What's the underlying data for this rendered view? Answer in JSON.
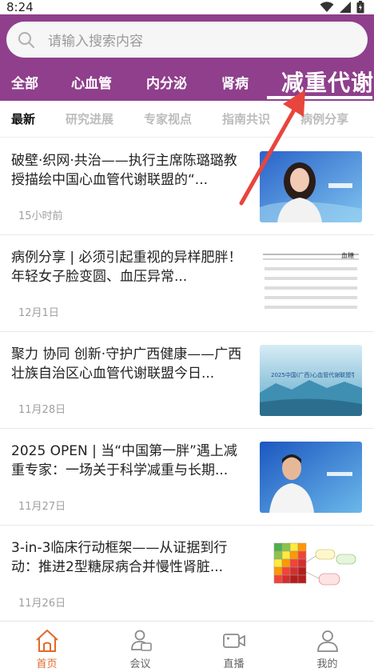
{
  "status_bar": {
    "time": "8:24"
  },
  "search": {
    "placeholder": "请输入搜索内容"
  },
  "categories": [
    {
      "label": "全部"
    },
    {
      "label": "心血管"
    },
    {
      "label": "内分泌"
    },
    {
      "label": "肾病"
    },
    {
      "label": "减重代谢",
      "active": true
    }
  ],
  "subtabs": [
    {
      "label": "最新",
      "active": true
    },
    {
      "label": "研究进展"
    },
    {
      "label": "专家视点"
    },
    {
      "label": "指南共识"
    },
    {
      "label": "病例分享"
    }
  ],
  "articles": [
    {
      "title": "破壁·织网·共治——执行主席陈璐璐教授描绘中国心血管代谢联盟的“...",
      "date": "15小时前",
      "thumb": "portrait-woman-blue"
    },
    {
      "title": "病例分享 | 必须引起重视的异样肥胖！年轻女子脸变圆、血压异常...",
      "date": "12月1日",
      "thumb": "lab-table",
      "thumb_text": "血糖"
    },
    {
      "title": "聚力 协同 创新·守护广西健康——广西壮族自治区心血管代谢联盟今日...",
      "date": "11月28日",
      "thumb": "conference-banner",
      "thumb_text": "2025中国(广西)心血管代谢联盟学术会议"
    },
    {
      "title": "2025 OPEN | 当“中国第一胖”遇上减重专家：一场关于科学减重与长期...",
      "date": "11月27日",
      "thumb": "portrait-man-blue"
    },
    {
      "title": "3-in-3临床行动框架——从证据到行动：推进2型糖尿病合并慢性肾脏...",
      "date": "11月26日",
      "thumb": "risk-grid-chart"
    }
  ],
  "tabbar": [
    {
      "label": "首页",
      "icon": "home-icon",
      "active": true
    },
    {
      "label": "会议",
      "icon": "meeting-icon"
    },
    {
      "label": "直播",
      "icon": "video-icon"
    },
    {
      "label": "我的",
      "icon": "profile-icon"
    }
  ],
  "colors": {
    "header": "#8f3f8c",
    "active_tab": "#e06a2a",
    "annotation_arrow": "#e8453c"
  }
}
